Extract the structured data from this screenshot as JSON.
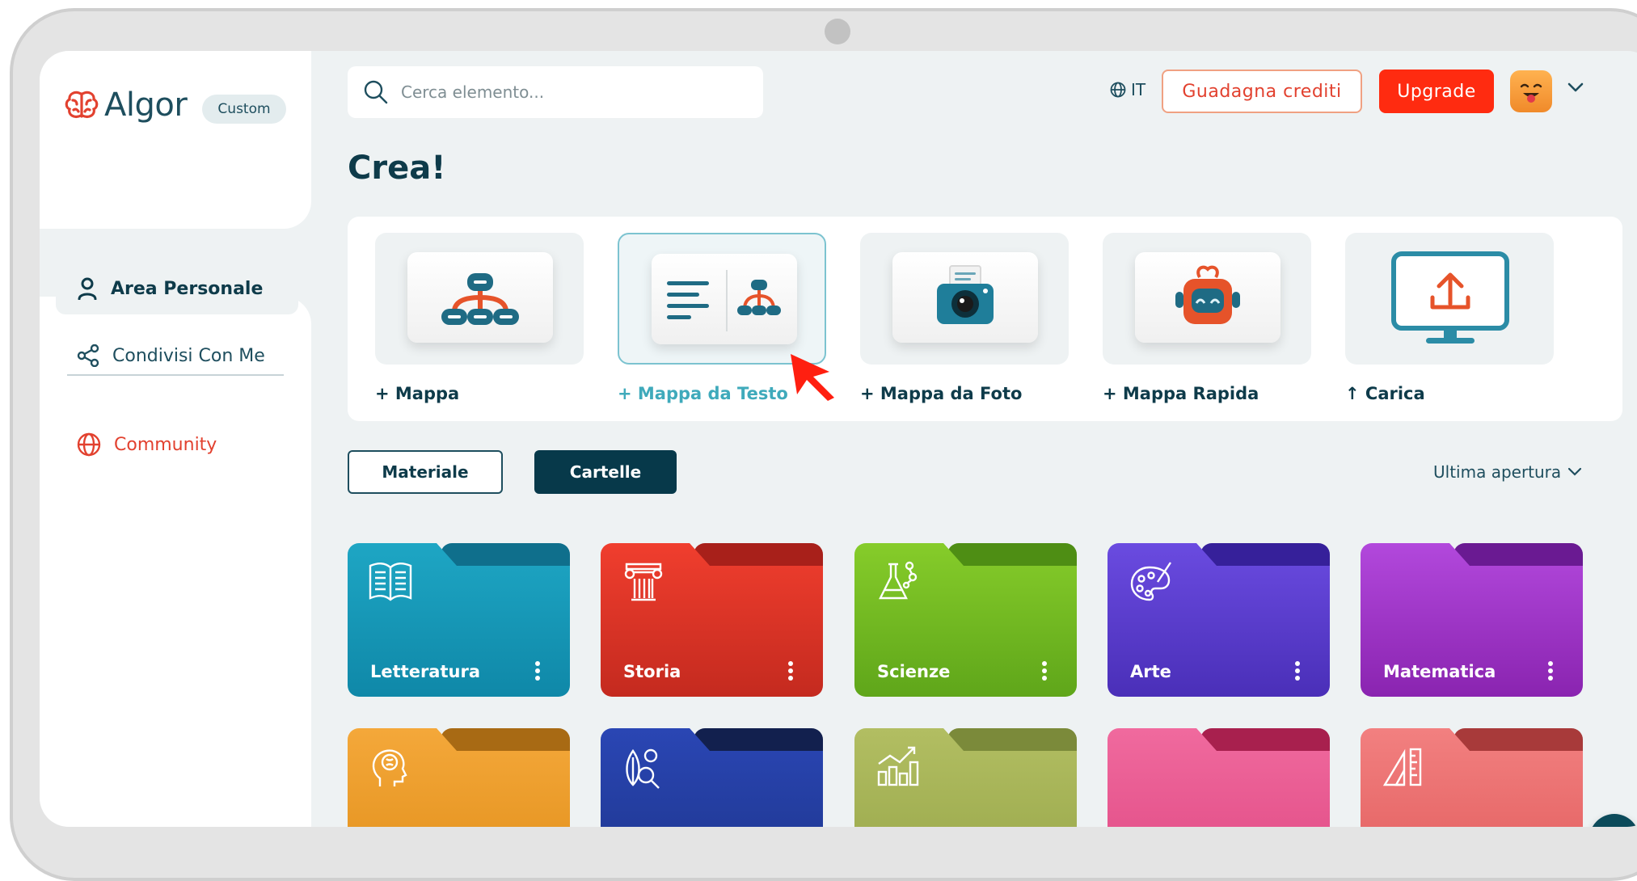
{
  "brand": {
    "name": "Algor",
    "plan_badge": "Custom"
  },
  "sidebar": {
    "items": [
      {
        "label": "Area Personale",
        "icon": "user-icon",
        "active": true
      },
      {
        "label": "Condivisi Con Me",
        "icon": "share-icon",
        "active": false
      },
      {
        "label": "Community",
        "icon": "globe-icon",
        "active": false
      }
    ]
  },
  "header": {
    "search_placeholder": "Cerca elemento...",
    "language": "IT",
    "credits_button": "Guadagna crediti",
    "upgrade_button": "Upgrade"
  },
  "main": {
    "title": "Crea!",
    "create_cards": [
      {
        "label": "+ Mappa",
        "icon": "mind-map-icon"
      },
      {
        "label": "+ Mappa da Testo",
        "icon": "text-to-map-icon",
        "selected": true
      },
      {
        "label": "+ Mappa da Foto",
        "icon": "camera-icon"
      },
      {
        "label": "+ Mappa Rapida",
        "icon": "robot-icon"
      },
      {
        "label": "↑ Carica",
        "icon": "upload-monitor-icon"
      }
    ],
    "tabs": [
      {
        "label": "Materiale",
        "active": false
      },
      {
        "label": "Cartelle",
        "active": true
      }
    ],
    "sort_label": "Ultima apertura",
    "folders": [
      {
        "name": "Letteratura",
        "icon": "book-icon",
        "color": "#1aa0c0"
      },
      {
        "name": "Storia",
        "icon": "column-icon",
        "color": "#e8392b"
      },
      {
        "name": "Scienze",
        "icon": "flask-icon",
        "color": "#7bc12a"
      },
      {
        "name": "Arte",
        "icon": "palette-icon",
        "color": "#5a3fd0"
      },
      {
        "name": "Matematica",
        "icon": "",
        "color": "#9b2fc4"
      },
      {
        "name": "",
        "icon": "head-brain-icon",
        "color": "#f0a030"
      },
      {
        "name": "",
        "icon": "leaf-search-icon",
        "color": "#2a44b0"
      },
      {
        "name": "",
        "icon": "chart-growth-icon",
        "color": "#a9b85a"
      },
      {
        "name": "",
        "icon": "",
        "color": "#ef5f92"
      },
      {
        "name": "",
        "icon": "ruler-triangle-icon",
        "color": "#ee6f6f"
      }
    ]
  }
}
